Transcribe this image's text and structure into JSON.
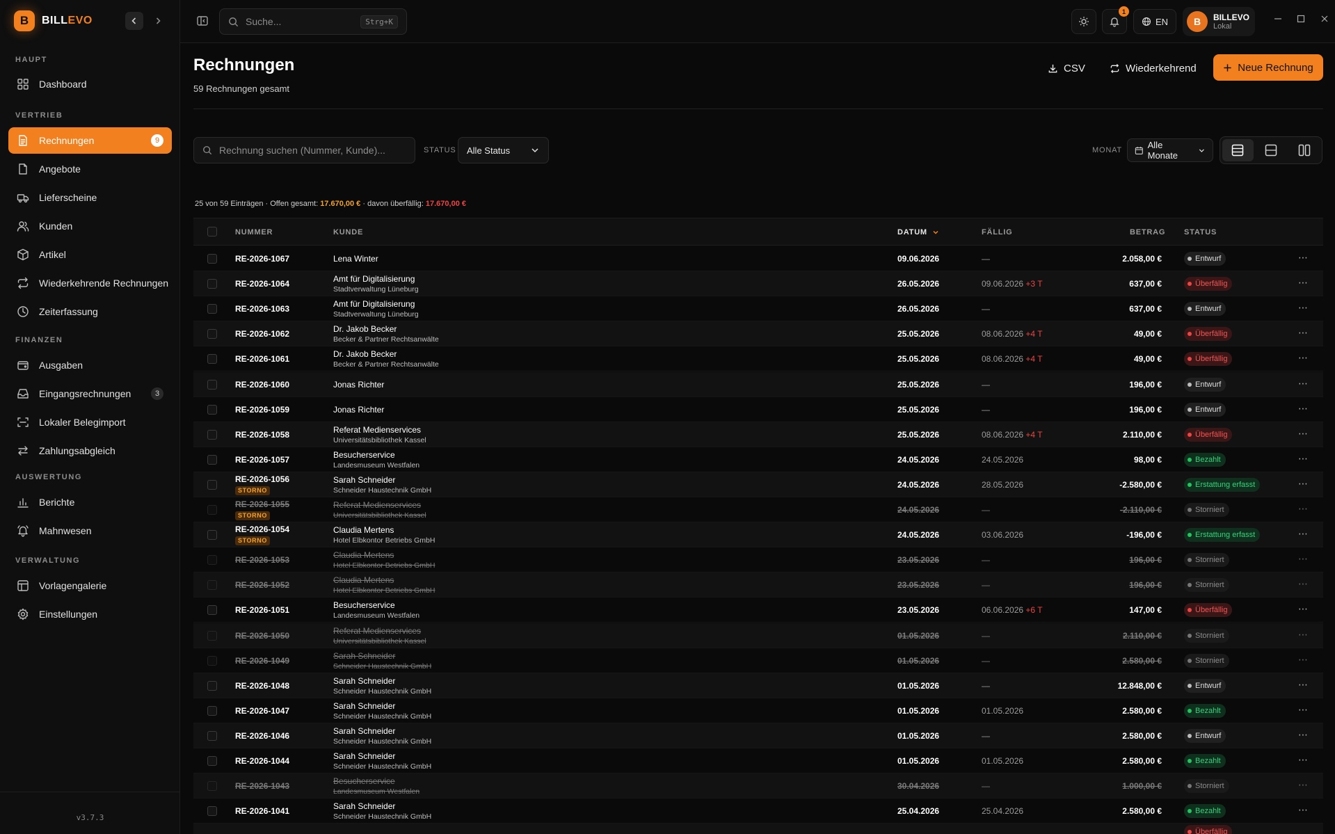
{
  "brand": {
    "name_a": "BILL",
    "name_b": "EVO",
    "logo_letter": "B"
  },
  "sidebar": {
    "sections": [
      {
        "title": "HAUPT",
        "items": [
          {
            "label": "Dashboard",
            "icon": "grid-icon"
          }
        ]
      },
      {
        "title": "VERTRIEB",
        "items": [
          {
            "label": "Rechnungen",
            "icon": "invoice-icon",
            "badge": "9",
            "active": true
          },
          {
            "label": "Angebote",
            "icon": "document-icon"
          },
          {
            "label": "Lieferscheine",
            "icon": "truck-icon"
          },
          {
            "label": "Kunden",
            "icon": "users-icon"
          },
          {
            "label": "Artikel",
            "icon": "package-icon"
          },
          {
            "label": "Wiederkehrende Rechnungen",
            "icon": "repeat-icon"
          },
          {
            "label": "Zeiterfassung",
            "icon": "clock-icon"
          }
        ]
      },
      {
        "title": "FINANZEN",
        "items": [
          {
            "label": "Ausgaben",
            "icon": "wallet-icon"
          },
          {
            "label": "Eingangsrechnungen",
            "icon": "inbox-icon",
            "badge": "3"
          },
          {
            "label": "Lokaler Belegimport",
            "icon": "scan-icon"
          },
          {
            "label": "Zahlungsabgleich",
            "icon": "arrows-icon"
          }
        ]
      },
      {
        "title": "AUSWERTUNG",
        "items": [
          {
            "label": "Berichte",
            "icon": "chart-icon"
          },
          {
            "label": "Mahnwesen",
            "icon": "bell-alert-icon"
          }
        ]
      },
      {
        "title": "VERWALTUNG",
        "items": [
          {
            "label": "Vorlagengalerie",
            "icon": "layout-icon"
          },
          {
            "label": "Einstellungen",
            "icon": "gear-icon"
          }
        ]
      }
    ],
    "version": "v3.7.3"
  },
  "topbar": {
    "search_placeholder": "Suche...",
    "search_shortcut": "Strg+K",
    "notification_count": "1",
    "language": "EN",
    "user": {
      "initial": "B",
      "name": "BILLEVO",
      "location": "Lokal"
    }
  },
  "page": {
    "title": "Rechnungen",
    "subtitle": "59 Rechnungen gesamt",
    "csv_label": "CSV",
    "recurring_label": "Wiederkehrend",
    "new_label": "Neue Rechnung"
  },
  "filters": {
    "search_placeholder": "Rechnung suchen (Nummer, Kunde)...",
    "status_label": "STATUS",
    "status_value": "Alle Status",
    "month_label": "MONAT",
    "month_value": "Alle Monate"
  },
  "summary": {
    "prefix": "25 von 59 Einträgen · Offen gesamt: ",
    "open_total": "17.670,00 €",
    "mid": " · davon überfällig: ",
    "overdue_total": "17.670,00 €"
  },
  "table": {
    "headers": {
      "number": "NUMMER",
      "customer": "KUNDE",
      "date": "DATUM",
      "due": "FÄLLIG",
      "amount": "BETRAG",
      "status": "STATUS"
    },
    "rows": [
      {
        "number": "RE-2026-1067",
        "customer": "Lena Winter",
        "sub": "",
        "date": "09.06.2026",
        "due": "—",
        "due_plus": "",
        "amount": "2.058,00 €",
        "status": "Entwurf",
        "kind": "entwurf"
      },
      {
        "number": "RE-2026-1064",
        "customer": "Amt für Digitalisierung",
        "sub": "Stadtverwaltung Lüneburg",
        "date": "26.05.2026",
        "due": "09.06.2026",
        "due_plus": "+3 T",
        "amount": "637,00 €",
        "status": "Überfällig",
        "kind": "ueber"
      },
      {
        "number": "RE-2026-1063",
        "customer": "Amt für Digitalisierung",
        "sub": "Stadtverwaltung Lüneburg",
        "date": "26.05.2026",
        "due": "—",
        "due_plus": "",
        "amount": "637,00 €",
        "status": "Entwurf",
        "kind": "entwurf"
      },
      {
        "number": "RE-2026-1062",
        "customer": "Dr. Jakob Becker",
        "sub": "Becker & Partner Rechtsanwälte",
        "date": "25.05.2026",
        "due": "08.06.2026",
        "due_plus": "+4 T",
        "amount": "49,00 €",
        "status": "Überfällig",
        "kind": "ueber"
      },
      {
        "number": "RE-2026-1061",
        "customer": "Dr. Jakob Becker",
        "sub": "Becker & Partner Rechtsanwälte",
        "date": "25.05.2026",
        "due": "08.06.2026",
        "due_plus": "+4 T",
        "amount": "49,00 €",
        "status": "Überfällig",
        "kind": "ueber"
      },
      {
        "number": "RE-2026-1060",
        "customer": "Jonas Richter",
        "sub": "",
        "date": "25.05.2026",
        "due": "—",
        "due_plus": "",
        "amount": "196,00 €",
        "status": "Entwurf",
        "kind": "entwurf"
      },
      {
        "number": "RE-2026-1059",
        "customer": "Jonas Richter",
        "sub": "",
        "date": "25.05.2026",
        "due": "—",
        "due_plus": "",
        "amount": "196,00 €",
        "status": "Entwurf",
        "kind": "entwurf"
      },
      {
        "number": "RE-2026-1058",
        "customer": "Referat Medienservices",
        "sub": "Universitätsbibliothek Kassel",
        "date": "25.05.2026",
        "due": "08.06.2026",
        "due_plus": "+4 T",
        "amount": "2.110,00 €",
        "status": "Überfällig",
        "kind": "ueber"
      },
      {
        "number": "RE-2026-1057",
        "customer": "Besucherservice",
        "sub": "Landesmuseum Westfalen",
        "date": "24.05.2026",
        "due": "24.05.2026",
        "due_plus": "",
        "amount": "98,00 €",
        "status": "Bezahlt",
        "kind": "bezahlt"
      },
      {
        "number": "RE-2026-1056",
        "customer": "Sarah Schneider",
        "sub": "Schneider Haustechnik GmbH",
        "date": "24.05.2026",
        "due": "28.05.2026",
        "due_plus": "",
        "amount": "-2.580,00 €",
        "status": "Erstattung erfasst",
        "kind": "erstattung",
        "storno": "STORNO"
      },
      {
        "number": "RE-2026-1055",
        "customer": "Referat Medienservices",
        "sub": "Universitätsbibliothek Kassel",
        "date": "24.05.2026",
        "due": "—",
        "due_plus": "",
        "amount": "-2.110,00 €",
        "status": "Storniert",
        "kind": "storniert",
        "storno": "STORNO",
        "cancel": true
      },
      {
        "number": "RE-2026-1054",
        "customer": "Claudia Mertens",
        "sub": "Hotel Elbkontor Betriebs GmbH",
        "date": "24.05.2026",
        "due": "03.06.2026",
        "due_plus": "",
        "amount": "-196,00 €",
        "status": "Erstattung erfasst",
        "kind": "erstattung",
        "storno": "STORNO"
      },
      {
        "number": "RE-2026-1053",
        "customer": "Claudia Mertens",
        "sub": "Hotel Elbkontor Betriebs GmbH",
        "date": "23.05.2026",
        "due": "—",
        "due_plus": "",
        "amount": "196,00 €",
        "status": "Storniert",
        "kind": "storniert",
        "cancel": true
      },
      {
        "number": "RE-2026-1052",
        "customer": "Claudia Mertens",
        "sub": "Hotel Elbkontor Betriebs GmbH",
        "date": "23.05.2026",
        "due": "—",
        "due_plus": "",
        "amount": "196,00 €",
        "status": "Storniert",
        "kind": "storniert",
        "cancel": true
      },
      {
        "number": "RE-2026-1051",
        "customer": "Besucherservice",
        "sub": "Landesmuseum Westfalen",
        "date": "23.05.2026",
        "due": "06.06.2026",
        "due_plus": "+6 T",
        "amount": "147,00 €",
        "status": "Überfällig",
        "kind": "ueber"
      },
      {
        "number": "RE-2026-1050",
        "customer": "Referat Medienservices",
        "sub": "Universitätsbibliothek Kassel",
        "date": "01.05.2026",
        "due": "—",
        "due_plus": "",
        "amount": "2.110,00 €",
        "status": "Storniert",
        "kind": "storniert",
        "cancel": true
      },
      {
        "number": "RE-2026-1049",
        "customer": "Sarah Schneider",
        "sub": "Schneider Haustechnik GmbH",
        "date": "01.05.2026",
        "due": "—",
        "due_plus": "",
        "amount": "2.580,00 €",
        "status": "Storniert",
        "kind": "storniert",
        "cancel": true
      },
      {
        "number": "RE-2026-1048",
        "customer": "Sarah Schneider",
        "sub": "Schneider Haustechnik GmbH",
        "date": "01.05.2026",
        "due": "—",
        "due_plus": "",
        "amount": "12.848,00 €",
        "status": "Entwurf",
        "kind": "entwurf"
      },
      {
        "number": "RE-2026-1047",
        "customer": "Sarah Schneider",
        "sub": "Schneider Haustechnik GmbH",
        "date": "01.05.2026",
        "due": "01.05.2026",
        "due_plus": "",
        "amount": "2.580,00 €",
        "status": "Bezahlt",
        "kind": "bezahlt"
      },
      {
        "number": "RE-2026-1046",
        "customer": "Sarah Schneider",
        "sub": "Schneider Haustechnik GmbH",
        "date": "01.05.2026",
        "due": "—",
        "due_plus": "",
        "amount": "2.580,00 €",
        "status": "Entwurf",
        "kind": "entwurf"
      },
      {
        "number": "RE-2026-1044",
        "customer": "Sarah Schneider",
        "sub": "Schneider Haustechnik GmbH",
        "date": "01.05.2026",
        "due": "01.05.2026",
        "due_plus": "",
        "amount": "2.580,00 €",
        "status": "Bezahlt",
        "kind": "bezahlt"
      },
      {
        "number": "RE-2026-1043",
        "customer": "Besucherservice",
        "sub": "Landesmuseum Westfalen",
        "date": "30.04.2026",
        "due": "—",
        "due_plus": "",
        "amount": "1.000,00 €",
        "status": "Storniert",
        "kind": "storniert",
        "cancel": true
      },
      {
        "number": "RE-2026-1041",
        "customer": "Sarah Schneider",
        "sub": "Schneider Haustechnik GmbH",
        "date": "25.04.2026",
        "due": "25.04.2026",
        "due_plus": "",
        "amount": "2.580,00 €",
        "status": "Bezahlt",
        "kind": "bezahlt"
      }
    ],
    "partial_row_status": "Überfällig"
  },
  "colors": {
    "accent": "#f2801f",
    "danger": "#ef4444",
    "success": "#22c55e",
    "background": "#0a0a0a"
  }
}
